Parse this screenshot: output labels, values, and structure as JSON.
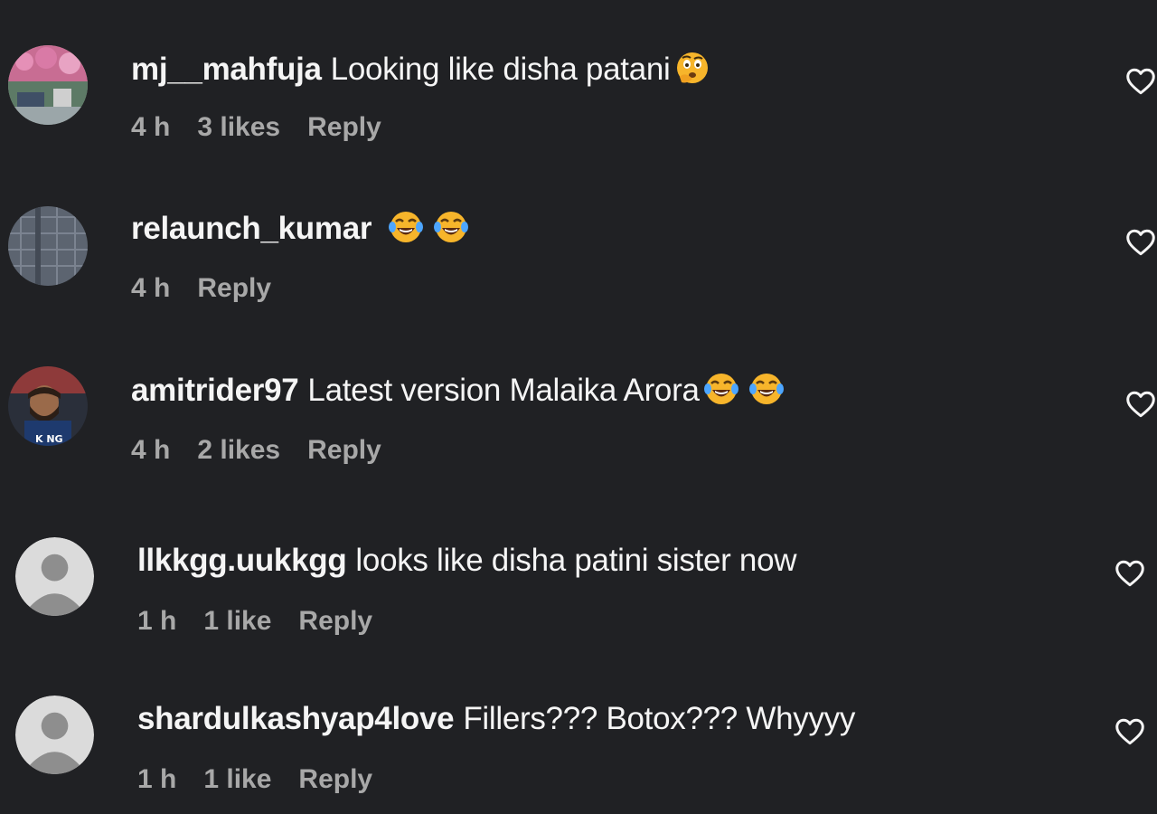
{
  "comments": [
    {
      "username": "mj__mahfuja",
      "text": "Looking like disha patani",
      "emojis": [
        "face-with-raised-eyebrow-hand"
      ],
      "time": "4 h",
      "likes": "3 likes",
      "reply": "Reply",
      "avatar": "photo-pink-flowers"
    },
    {
      "username": "relaunch_kumar",
      "text": "",
      "emojis": [
        "tears-of-joy",
        "tears-of-joy"
      ],
      "time": "4 h",
      "likes": "",
      "reply": "Reply",
      "avatar": "photo-checked-shirt"
    },
    {
      "username": "amitrider97",
      "text": "Latest version Malaika Arora",
      "emojis": [
        "tears-of-joy",
        "tears-of-joy"
      ],
      "time": "4 h",
      "likes": "2 likes",
      "reply": "Reply",
      "avatar": "photo-man-beard"
    },
    {
      "username": "llkkgg.uukkgg",
      "text": "looks like disha patini sister now",
      "emojis": [],
      "time": "1 h",
      "likes": "1 like",
      "reply": "Reply",
      "avatar": "default-person"
    },
    {
      "username": "shardulkashyap4love",
      "text": "Fillers??? Botox??? Whyyyy",
      "emojis": [],
      "time": "1 h",
      "likes": "1 like",
      "reply": "Reply",
      "avatar": "default-person"
    }
  ],
  "colors": {
    "background": "#202124",
    "text": "#f5f5f5",
    "meta": "#a8a8a8",
    "emoji_yellow": "#f7b52b"
  }
}
